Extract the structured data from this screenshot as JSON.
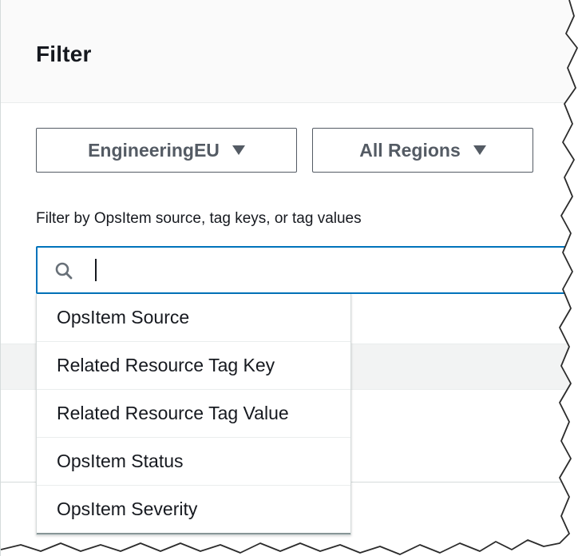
{
  "filter_panel": {
    "title": "Filter",
    "account_selector": {
      "label": "EngineeringEU"
    },
    "region_selector": {
      "label": "All Regions"
    },
    "search": {
      "label": "Filter by OpsItem source, tag keys, or tag values",
      "value": "",
      "placeholder": ""
    },
    "suggestions": [
      {
        "label": "OpsItem Source"
      },
      {
        "label": "Related Resource Tag Key"
      },
      {
        "label": "Related Resource Tag Value"
      },
      {
        "label": "OpsItem Status"
      },
      {
        "label": "OpsItem Severity"
      }
    ]
  },
  "colors": {
    "accent": "#0073bb",
    "text": "#16191f",
    "muted": "#545b64",
    "header_bg": "#fafafa"
  },
  "icons": {
    "search": "search-icon",
    "dropdown": "caret-down-icon"
  }
}
